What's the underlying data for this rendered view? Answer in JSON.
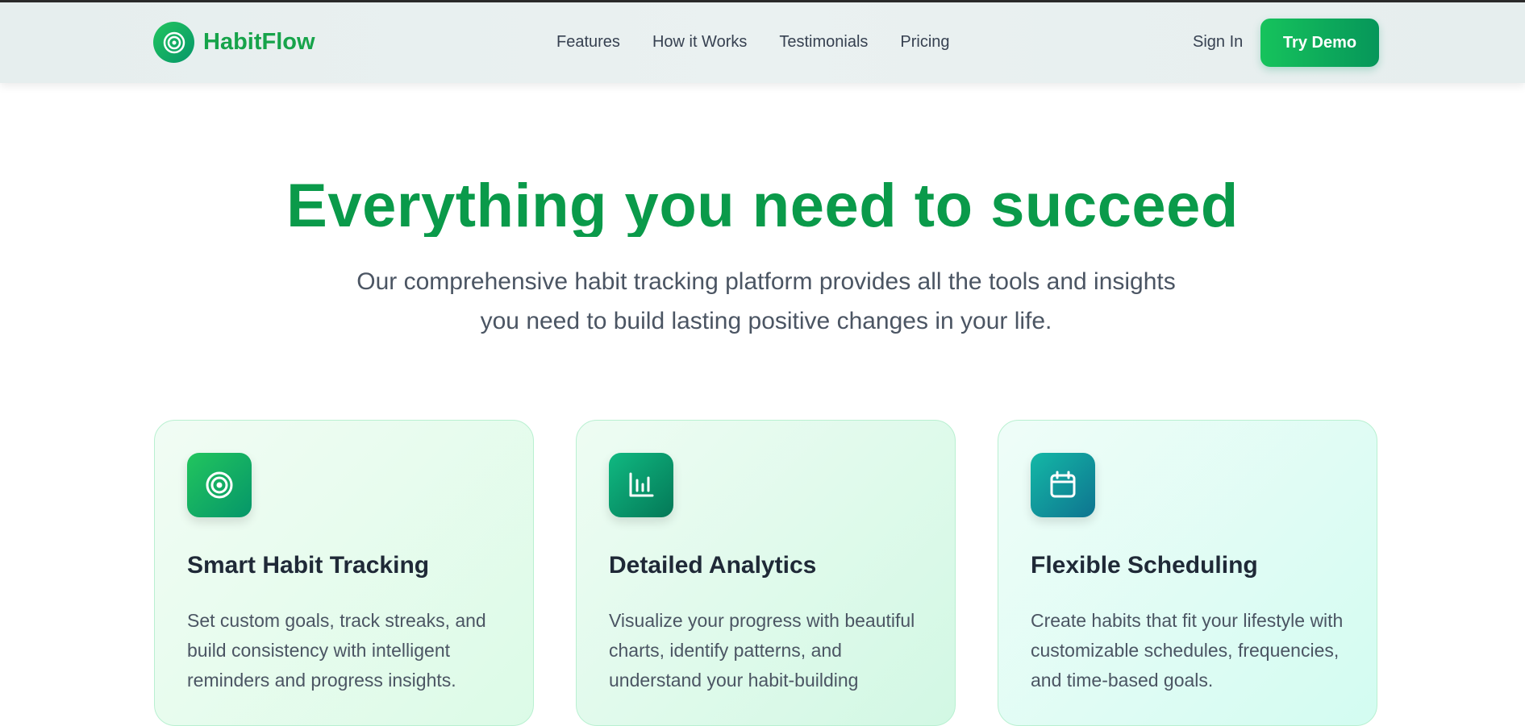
{
  "brand": {
    "name": "HabitFlow",
    "icon": "target-icon"
  },
  "nav": {
    "links": [
      "Features",
      "How it Works",
      "Testimonials",
      "Pricing"
    ],
    "sign_in": "Sign In",
    "cta": "Try Demo"
  },
  "hero": {
    "title": "Everything you need to succeed",
    "subtitle": "Our comprehensive habit tracking platform provides all the tools and insights you need to build lasting positive changes in your life."
  },
  "features": [
    {
      "icon": "target-icon",
      "title": "Smart Habit Tracking",
      "description": "Set custom goals, track streaks, and build consistency with intelligent reminders and progress insights."
    },
    {
      "icon": "bar-chart-icon",
      "title": "Detailed Analytics",
      "description": "Visualize your progress with beautiful charts, identify patterns, and understand your habit-building"
    },
    {
      "icon": "calendar-icon",
      "title": "Flexible Scheduling",
      "description": "Create habits that fit your lifestyle with customizable schedules, frequencies, and time-based goals."
    }
  ],
  "colors": {
    "brand_green": "#16a34a",
    "title_green": "#0a9a4a",
    "teal": "#0e7490"
  }
}
